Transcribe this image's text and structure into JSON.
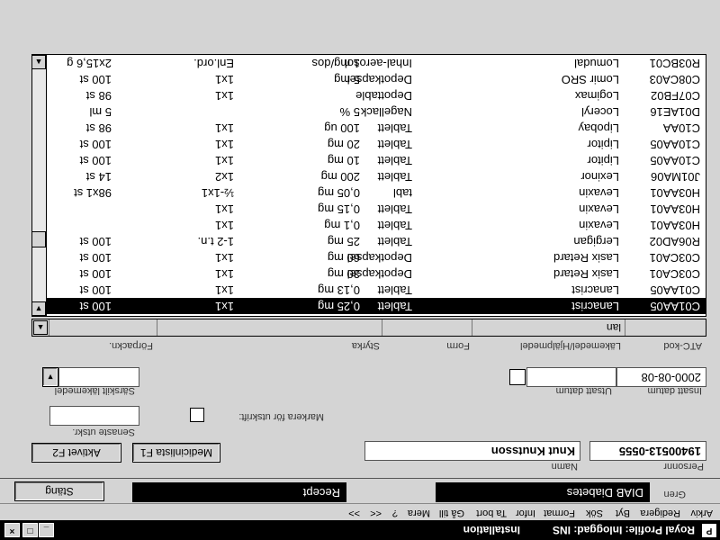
{
  "titlebar": {
    "title": "Royal Profile: Inloggad: INS",
    "section": "Installation",
    "minimize": "_",
    "maximize": "□",
    "close": "×"
  },
  "menu": [
    "Arkiv",
    "Redigera",
    "Byt",
    "Sök",
    "Format",
    "Infor",
    "Ta bort",
    "Gå till",
    "Mera",
    "?",
    "<<",
    ">>"
  ],
  "bar": {
    "gren_label": "Gren",
    "gren_value": "DIAB Diabetes",
    "recept_value": "Recept",
    "close_button": "Stäng"
  },
  "patient": {
    "personnr_label": "Personnr",
    "personnr_value": "19400513-0555",
    "namn_label": "Namn",
    "namn_value": "Knut Knutsson"
  },
  "buttons": {
    "medicinlista": "Medicinlista F1",
    "aktivet": "Aktivet  F2"
  },
  "options": {
    "senaste_label": "Senaste utskr.",
    "markera_label": "Markera för utskrift:",
    "sarskilt_label": "Särskilt läkemedel"
  },
  "dates": {
    "insatt_label": "Insatt datum",
    "insatt_value": "2000-08-08",
    "utsatt_label": "Utsatt datum"
  },
  "columns": [
    "ATC-kod",
    "Läkemedel/Hjälpmedel",
    "Form",
    "Styrka",
    "Förpackn."
  ],
  "filter": {
    "value": "lan"
  },
  "rows": [
    {
      "atc": "C01AA05",
      "name": "Lanacrist",
      "form": "Tablett",
      "styrka": "0,25 mg",
      "dos": "1x1",
      "forp": "100 st",
      "selected": true
    },
    {
      "atc": "C01AA05",
      "name": "Lanacrist",
      "form": "Tablett",
      "styrka": "0,13 mg",
      "dos": "1x1",
      "forp": "100 st"
    },
    {
      "atc": "C03CA01",
      "name": "Lasix Retard",
      "form": "Depotkapsel",
      "styrka": "30 mg",
      "dos": "1x1",
      "forp": "100 st"
    },
    {
      "atc": "C03CA01",
      "name": "Lasix Retard",
      "form": "Depotkapsel",
      "styrka": "60 mg",
      "dos": "1x1",
      "forp": "100 st"
    },
    {
      "atc": "R06AD02",
      "name": "Lergigan",
      "form": "Tablett",
      "styrka": "25 mg",
      "dos": "1-2 t.n.",
      "forp": "100 st"
    },
    {
      "atc": "H03AA01",
      "name": "Levaxin",
      "form": "Tablett",
      "styrka": "0,1 mg",
      "dos": "1x1",
      "forp": ""
    },
    {
      "atc": "H03AA01",
      "name": "Levaxin",
      "form": "Tablett",
      "styrka": "0,15 mg",
      "dos": "1x1",
      "forp": ""
    },
    {
      "atc": "H03AA01",
      "name": "Levaxin",
      "form": "tabl",
      "styrka": "0,05 mg",
      "dos": "½-1x1",
      "forp": "98x1 st"
    },
    {
      "atc": "J01MA06",
      "name": "Lexinor",
      "form": "Tablett",
      "styrka": "200 mg",
      "dos": "1x2",
      "forp": "14 st"
    },
    {
      "atc": "C10AA05",
      "name": "Lipitor",
      "form": "Tablett",
      "styrka": "10 mg",
      "dos": "1x1",
      "forp": "100 st"
    },
    {
      "atc": "C10AA05",
      "name": "Lipitor",
      "form": "Tablett",
      "styrka": "20 mg",
      "dos": "1x1",
      "forp": "100 st"
    },
    {
      "atc": "C10AA",
      "name": "Lipobay",
      "form": "Tablett",
      "styrka": "100 ug",
      "dos": "1x1",
      "forp": "98 st"
    },
    {
      "atc": "D01AE16",
      "name": "Loceryl",
      "form": "Nagellack",
      "styrka": "5 %",
      "dos": "",
      "forp": "5 ml"
    },
    {
      "atc": "C07FB02",
      "name": "Logimax",
      "form": "Depottable",
      "styrka": "",
      "dos": "1x1",
      "forp": "98 st"
    },
    {
      "atc": "C08CA03",
      "name": "Lomir SRO",
      "form": "Depotkapsel",
      "styrka": "5 mg",
      "dos": "1x1",
      "forp": "100 st"
    },
    {
      "atc": "R03BC01",
      "name": "Lomudal",
      "form": "Inhal-aerosol",
      "styrka": "1 mg/dos",
      "dos": "Enl.ord.",
      "forp": "2x15,6 g"
    }
  ],
  "scroll": {
    "up": "▲",
    "down": "▼",
    "position": 0.75
  }
}
